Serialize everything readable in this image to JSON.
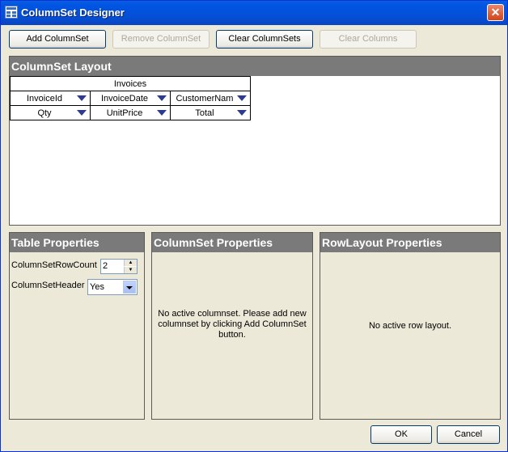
{
  "window": {
    "title": "ColumnSet Designer",
    "close_glyph": "✕"
  },
  "toolbar": {
    "add_columnset": "Add ColumnSet",
    "remove_columnset": "Remove ColumnSet",
    "clear_columnsets": "Clear ColumnSets",
    "clear_columns": "Clear Columns"
  },
  "layout_panel": {
    "title": "ColumnSet Layout",
    "columnset_name": "Invoices",
    "rows": [
      [
        "InvoiceId",
        "InvoiceDate",
        "CustomerNam"
      ],
      [
        "Qty",
        "UnitPrice",
        "Total"
      ]
    ]
  },
  "table_properties": {
    "title": "Table Properties",
    "row_count_label": "ColumnSetRowCount",
    "row_count_value": "2",
    "header_label": "ColumnSetHeader",
    "header_value": "Yes"
  },
  "columnset_properties": {
    "title": "ColumnSet Properties",
    "message": "No active columnset. Please add new columnset by clicking Add ColumnSet button."
  },
  "rowlayout_properties": {
    "title": "RowLayout Properties",
    "message": "No active row layout."
  },
  "footer": {
    "ok": "OK",
    "cancel": "Cancel"
  },
  "colors": {
    "titlebar": "#0054e3",
    "panel_header": "#7a7a7a",
    "dropdown_arrow": "#2d3c8c"
  },
  "icons": {
    "app": "columnset-designer-icon",
    "close": "close-icon",
    "dropdown": "dropdown-arrow-icon"
  }
}
